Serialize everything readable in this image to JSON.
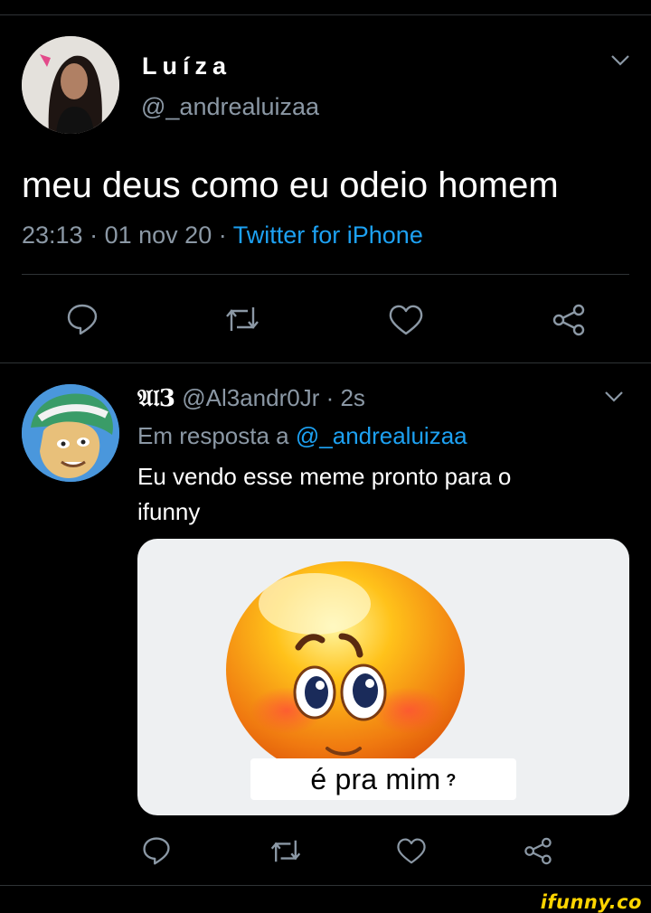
{
  "tweet": {
    "display_name": "Luíza",
    "handle": "@_andrealuizaa",
    "text": "meu deus como eu odeio homem",
    "time": "23:13",
    "sep1": "·",
    "date": "01 nov 20",
    "sep2": "·",
    "source": "Twitter for iPhone",
    "avatar_icon": "person-photo"
  },
  "reply": {
    "display_name": "𝔄𝔩3",
    "handle_time": "@Al3andr0Jr · 2s",
    "replying_prefix": "Em resposta a",
    "replying_to": "@_andrealuizaa",
    "text_line1": "Eu vendo esse meme pronto para o",
    "text_line2": "ifunny",
    "media_caption": "é pra mim",
    "media_caption_mark": "?",
    "avatar_icon": "cartoon-character"
  },
  "actions": [
    "reply-icon",
    "retweet-icon",
    "like-icon",
    "share-icon"
  ],
  "watermark": "ifunny.co",
  "colors": {
    "background": "#000000",
    "link": "#1da1f2",
    "muted": "#8b98a5",
    "divider": "#2f3336",
    "watermark": "#ffd500"
  }
}
